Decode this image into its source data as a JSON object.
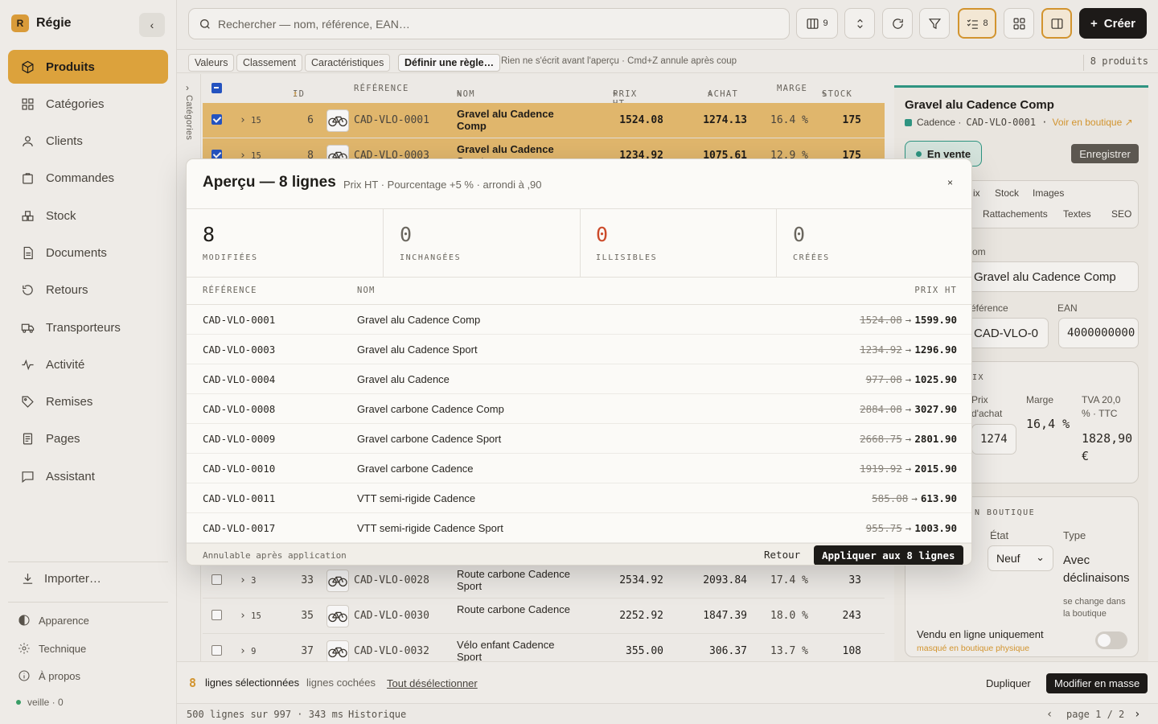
{
  "app": {
    "name": "Régie",
    "logo_glyph": "R"
  },
  "sidebar": {
    "items": [
      {
        "label": "Produits",
        "icon": "box-icon",
        "active": true
      },
      {
        "label": "Catégories",
        "icon": "grid-icon"
      },
      {
        "label": "Clients",
        "icon": "user-icon"
      },
      {
        "label": "Commandes",
        "icon": "bag-icon"
      },
      {
        "label": "Stock",
        "icon": "boxes-icon"
      },
      {
        "label": "Documents",
        "icon": "file-icon"
      },
      {
        "label": "Retours",
        "icon": "return-icon"
      },
      {
        "label": "Transporteurs",
        "icon": "truck-icon"
      },
      {
        "label": "Activité",
        "icon": "activity-icon"
      },
      {
        "label": "Remises",
        "icon": "tag-icon"
      },
      {
        "label": "Pages",
        "icon": "page-icon"
      },
      {
        "label": "Assistant",
        "icon": "chat-icon"
      }
    ],
    "import_label": "Importer…",
    "bottom": [
      {
        "label": "Apparence",
        "icon": "contrast-icon"
      },
      {
        "label": "Technique",
        "icon": "gear-icon"
      },
      {
        "label": "À propos",
        "icon": "info-icon"
      }
    ],
    "status": "veille · 0"
  },
  "topbar": {
    "search_placeholder": "Rechercher — nom, référence, EAN…",
    "columns_count": "9",
    "checklist_count": "8",
    "create_label": "Créer",
    "create_glyph": "+"
  },
  "subbar": {
    "chips": [
      "Valeurs",
      "Classement",
      "Caractéristiques"
    ],
    "rule_label": "Définir une règle…",
    "note": "Rien ne s'écrit avant l'aperçu · Cmd+Z annule après coup",
    "product_count": "8 produits"
  },
  "categories_rail": {
    "label": "Catégories",
    "arrow": "›"
  },
  "table": {
    "headers": {
      "id": "ID",
      "id_sort": "↑",
      "ref": "RÉFÉRENCE",
      "nom": "NOM",
      "prix": "PRIX HT",
      "achat": "ACHAT",
      "marge": "MARGE",
      "stock": "STOCK",
      "edit_glyph": "✎"
    },
    "rows": [
      {
        "expand": "15",
        "id": "6",
        "ref": "CAD-VLO-0001",
        "nom": "Gravel alu Cadence Comp",
        "prix": "1524.08",
        "achat": "1274.13",
        "marge": "16.4 %",
        "stock": "175",
        "selected": true
      },
      {
        "expand": "15",
        "id": "8",
        "ref": "CAD-VLO-0003",
        "nom": "Gravel alu Cadence Sport",
        "prix": "1234.92",
        "achat": "1075.61",
        "marge": "12.9 %",
        "stock": "175",
        "selected": true
      },
      {
        "expand": "3",
        "id": "33",
        "ref": "CAD-VLO-0028",
        "nom": "Route carbone Cadence Sport",
        "prix": "2534.92",
        "achat": "2093.84",
        "marge": "17.4 %",
        "stock": "33",
        "selected": false
      },
      {
        "expand": "15",
        "id": "35",
        "ref": "CAD-VLO-0030",
        "nom": "Route carbone Cadence",
        "prix": "2252.92",
        "achat": "1847.39",
        "marge": "18.0 %",
        "stock": "243",
        "selected": false
      },
      {
        "expand": "9",
        "id": "37",
        "ref": "CAD-VLO-0032",
        "nom": "Vélo enfant Cadence Sport",
        "prix": "355.00",
        "achat": "306.37",
        "marge": "13.7 %",
        "stock": "108",
        "selected": false
      }
    ]
  },
  "panel": {
    "title": "Gravel alu Cadence Comp",
    "brand": "Cadence ·",
    "ref": "CAD-VLO-0001 ·",
    "shop_link": "Voir en boutique ↗",
    "status": "En vente",
    "save_label": "Enregistrer",
    "tabs_row1": [
      "ix",
      "Stock",
      "Images"
    ],
    "tabs_row2": [
      "Rattachements",
      "Textes",
      "SEO"
    ],
    "name_label": "om",
    "name_value": "Gravel alu Cadence Comp",
    "ref_label": "éférence",
    "ref_value": "CAD-VLO-0",
    "ean_label": "EAN",
    "ean_value": "4000000000",
    "price_section": "IX",
    "purchase_label_1": "Prix",
    "purchase_label_2": "d'achat",
    "purchase_value": "1274",
    "margin_label": "Marge",
    "margin_value": "16,4 %",
    "ttc_label_1": "TVA 20,0",
    "ttc_label_2": "% · TTC",
    "ttc_value_1": "1828,90",
    "ttc_value_2": "€",
    "shop_section": "N BOUTIQUE",
    "state_label": "État",
    "state_value": "Neuf",
    "type_label": "Type",
    "type_value_1": "Avec",
    "type_value_2": "déclinaisons",
    "type_hint_1": "se change dans",
    "type_hint_2": "la boutique",
    "online_only_label": "Vendu en ligne uniquement",
    "online_only_hint": "masqué en boutique physique"
  },
  "selection_bar": {
    "count": "8",
    "selected_label": "lignes sélectionnées",
    "checked_label": "lignes cochées",
    "deselect_label": "Tout désélectionner",
    "duplicate_label": "Dupliquer",
    "bulk_edit_label": "Modifier en masse"
  },
  "status_bar": {
    "rows_info": "500 lignes sur 997 · 343 ms",
    "history": "Historique",
    "page": "page 1 / 2",
    "prev": "‹",
    "next": "›"
  },
  "modal": {
    "title": "Aperçu — 8 lignes",
    "subtitle": "Prix HT · Pourcentage +5 % · arrondi à ,90",
    "close": "×",
    "stats": [
      {
        "value": "8",
        "label": "MODIFIÉES"
      },
      {
        "value": "0",
        "label": "INCHANGÉES"
      },
      {
        "value": "0",
        "label": "ILLISIBLES"
      },
      {
        "value": "0",
        "label": "CRÉÉES"
      }
    ],
    "headers": {
      "ref": "RÉFÉRENCE",
      "nom": "NOM",
      "prix": "PRIX HT"
    },
    "rows": [
      {
        "ref": "CAD-VLO-0001",
        "nom": "Gravel alu Cadence Comp",
        "old": "1524.08",
        "new": "1599.90"
      },
      {
        "ref": "CAD-VLO-0003",
        "nom": "Gravel alu Cadence Sport",
        "old": "1234.92",
        "new": "1296.90"
      },
      {
        "ref": "CAD-VLO-0004",
        "nom": "Gravel alu Cadence",
        "old": "977.08",
        "new": "1025.90"
      },
      {
        "ref": "CAD-VLO-0008",
        "nom": "Gravel carbone Cadence Comp",
        "old": "2884.08",
        "new": "3027.90"
      },
      {
        "ref": "CAD-VLO-0009",
        "nom": "Gravel carbone Cadence Sport",
        "old": "2668.75",
        "new": "2801.90"
      },
      {
        "ref": "CAD-VLO-0010",
        "nom": "Gravel carbone Cadence",
        "old": "1919.92",
        "new": "2015.90"
      },
      {
        "ref": "CAD-VLO-0011",
        "nom": "VTT semi-rigide Cadence",
        "old": "585.08",
        "new": "613.90"
      },
      {
        "ref": "CAD-VLO-0017",
        "nom": "VTT semi-rigide Cadence Sport",
        "old": "955.75",
        "new": "1003.90"
      }
    ],
    "arrow": "→",
    "footer_note": "Annulable après application",
    "back_label": "Retour",
    "apply_label": "Appliquer aux 8 lignes"
  }
}
